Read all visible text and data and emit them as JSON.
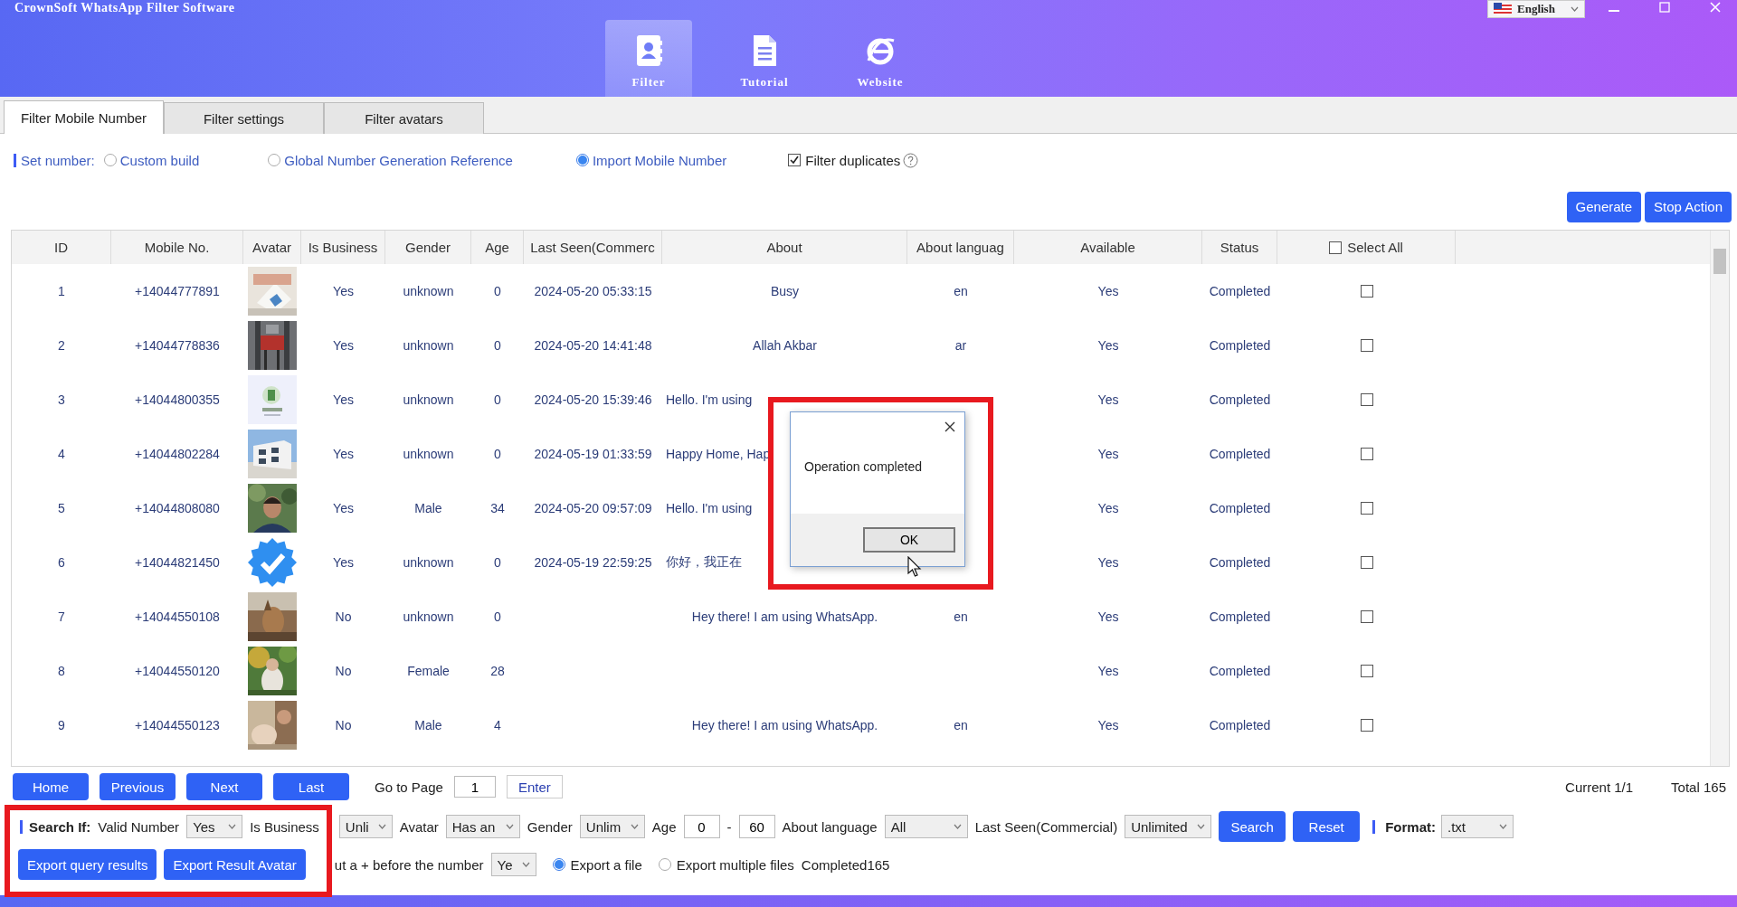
{
  "window": {
    "title": "CrownSoft WhatsApp Filter Software",
    "language": "English"
  },
  "nav": [
    {
      "label": "Filter",
      "kind": "contacts",
      "selected": true
    },
    {
      "label": "Tutorial",
      "kind": "document",
      "selected": false
    },
    {
      "label": "Website",
      "kind": "browser",
      "selected": false
    }
  ],
  "tabs": [
    {
      "label": "Filter Mobile Number",
      "selected": true
    },
    {
      "label": "Filter settings",
      "selected": false
    },
    {
      "label": "Filter avatars",
      "selected": false
    }
  ],
  "set_number": {
    "label": "Set number:",
    "options": [
      {
        "label": "Custom build",
        "selected": false
      },
      {
        "label": "Global Number Generation Reference",
        "selected": false
      },
      {
        "label": "Import Mobile Number",
        "selected": true
      }
    ],
    "filter_duplicates": {
      "label": "Filter duplicates",
      "checked": true
    }
  },
  "actions": [
    "Generate",
    "Stop Action"
  ],
  "table": {
    "columns": [
      "ID",
      "Mobile No.",
      "Avatar",
      "Is Business",
      "Gender",
      "Age",
      "Last Seen(Commerc",
      "About",
      "About languag",
      "Available",
      "Status",
      "Select All"
    ],
    "select_all_checked": false,
    "rows": [
      {
        "id": "1",
        "mobile": "+14044777891",
        "business": "Yes",
        "gender": "unknown",
        "age": "0",
        "last_seen": "2024-05-20 05:33:15",
        "about": "Busy",
        "about_language": "en",
        "available": "Yes",
        "status": "Completed",
        "checked": false
      },
      {
        "id": "2",
        "mobile": "+14044778836",
        "business": "Yes",
        "gender": "unknown",
        "age": "0",
        "last_seen": "2024-05-20 14:41:48",
        "about": "Allah Akbar",
        "about_language": "ar",
        "available": "Yes",
        "status": "Completed",
        "checked": false
      },
      {
        "id": "3",
        "mobile": "+14044800355",
        "business": "Yes",
        "gender": "unknown",
        "age": "0",
        "last_seen": "2024-05-20 15:39:46",
        "about": "Hello. I'm using",
        "available": "Yes",
        "status": "Completed",
        "checked": false
      },
      {
        "id": "4",
        "mobile": "+14044802284",
        "business": "Yes",
        "gender": "unknown",
        "age": "0",
        "last_seen": "2024-05-19 01:33:59",
        "about": "Happy Home, Hap",
        "available": "Yes",
        "status": "Completed",
        "checked": false
      },
      {
        "id": "5",
        "mobile": "+14044808080",
        "business": "Yes",
        "gender": "Male",
        "age": "34",
        "last_seen": "2024-05-20 09:57:09",
        "about": "Hello. I'm using",
        "available": "Yes",
        "status": "Completed",
        "checked": false
      },
      {
        "id": "6",
        "mobile": "+14044821450",
        "avatar": {
          "kind": "badge"
        },
        "business": "Yes",
        "gender": "unknown",
        "age": "0",
        "last_seen": "2024-05-19 22:59:25",
        "about": "你好，我正在",
        "available": "Yes",
        "status": "Completed",
        "checked": false
      },
      {
        "id": "7",
        "mobile": "+14044550108",
        "business": "No",
        "gender": "unknown",
        "age": "0",
        "about": "Hey there! I am using WhatsApp.",
        "about_language": "en",
        "available": "Yes",
        "status": "Completed",
        "checked": false
      },
      {
        "id": "8",
        "mobile": "+14044550120",
        "business": "No",
        "gender": "Female",
        "age": "28",
        "available": "Yes",
        "status": "Completed",
        "checked": false
      },
      {
        "id": "9",
        "mobile": "+14044550123",
        "business": "No",
        "gender": "Male",
        "age": "4",
        "about": "Hey there! I am using WhatsApp.",
        "about_language": "en",
        "available": "Yes",
        "status": "Completed",
        "checked": false
      }
    ]
  },
  "dialog": {
    "message": "Operation completed",
    "button": "OK"
  },
  "pagination": {
    "buttons": [
      "Home",
      "Previous",
      "Next",
      "Last"
    ],
    "go_to_label": "Go to Page",
    "page": "1",
    "enter": "Enter",
    "current": "Current 1/1",
    "total": "Total 165"
  },
  "search": {
    "label": "Search If:",
    "filters": [
      {
        "kind": "select",
        "label": "Valid Number",
        "value": "Yes"
      },
      {
        "kind": "select",
        "label": "Is Business",
        "value": "Unli"
      },
      {
        "kind": "select",
        "label": "Avatar",
        "value": "Has an"
      },
      {
        "kind": "select",
        "label": "Gender",
        "value": "Unlim"
      },
      {
        "kind": "range",
        "label": "Age",
        "from": "0",
        "separator": "-",
        "to": "60"
      },
      {
        "kind": "select",
        "label": "About language",
        "value": "All"
      },
      {
        "kind": "select",
        "label": "Last Seen(Commercial)",
        "value": "Unlimited"
      }
    ],
    "buttons": [
      "Search",
      "Reset"
    ],
    "format": {
      "label": "Format:",
      "value": ".txt"
    }
  },
  "export": {
    "buttons": [
      "Export query results",
      "Export Result Avatar"
    ],
    "plus_label": "ut a + before the number",
    "plus_value": "Ye",
    "modes": [
      {
        "label": "Export a file",
        "selected": true
      },
      {
        "label": "Export multiple files",
        "selected": false
      }
    ],
    "result": "Completed165"
  }
}
